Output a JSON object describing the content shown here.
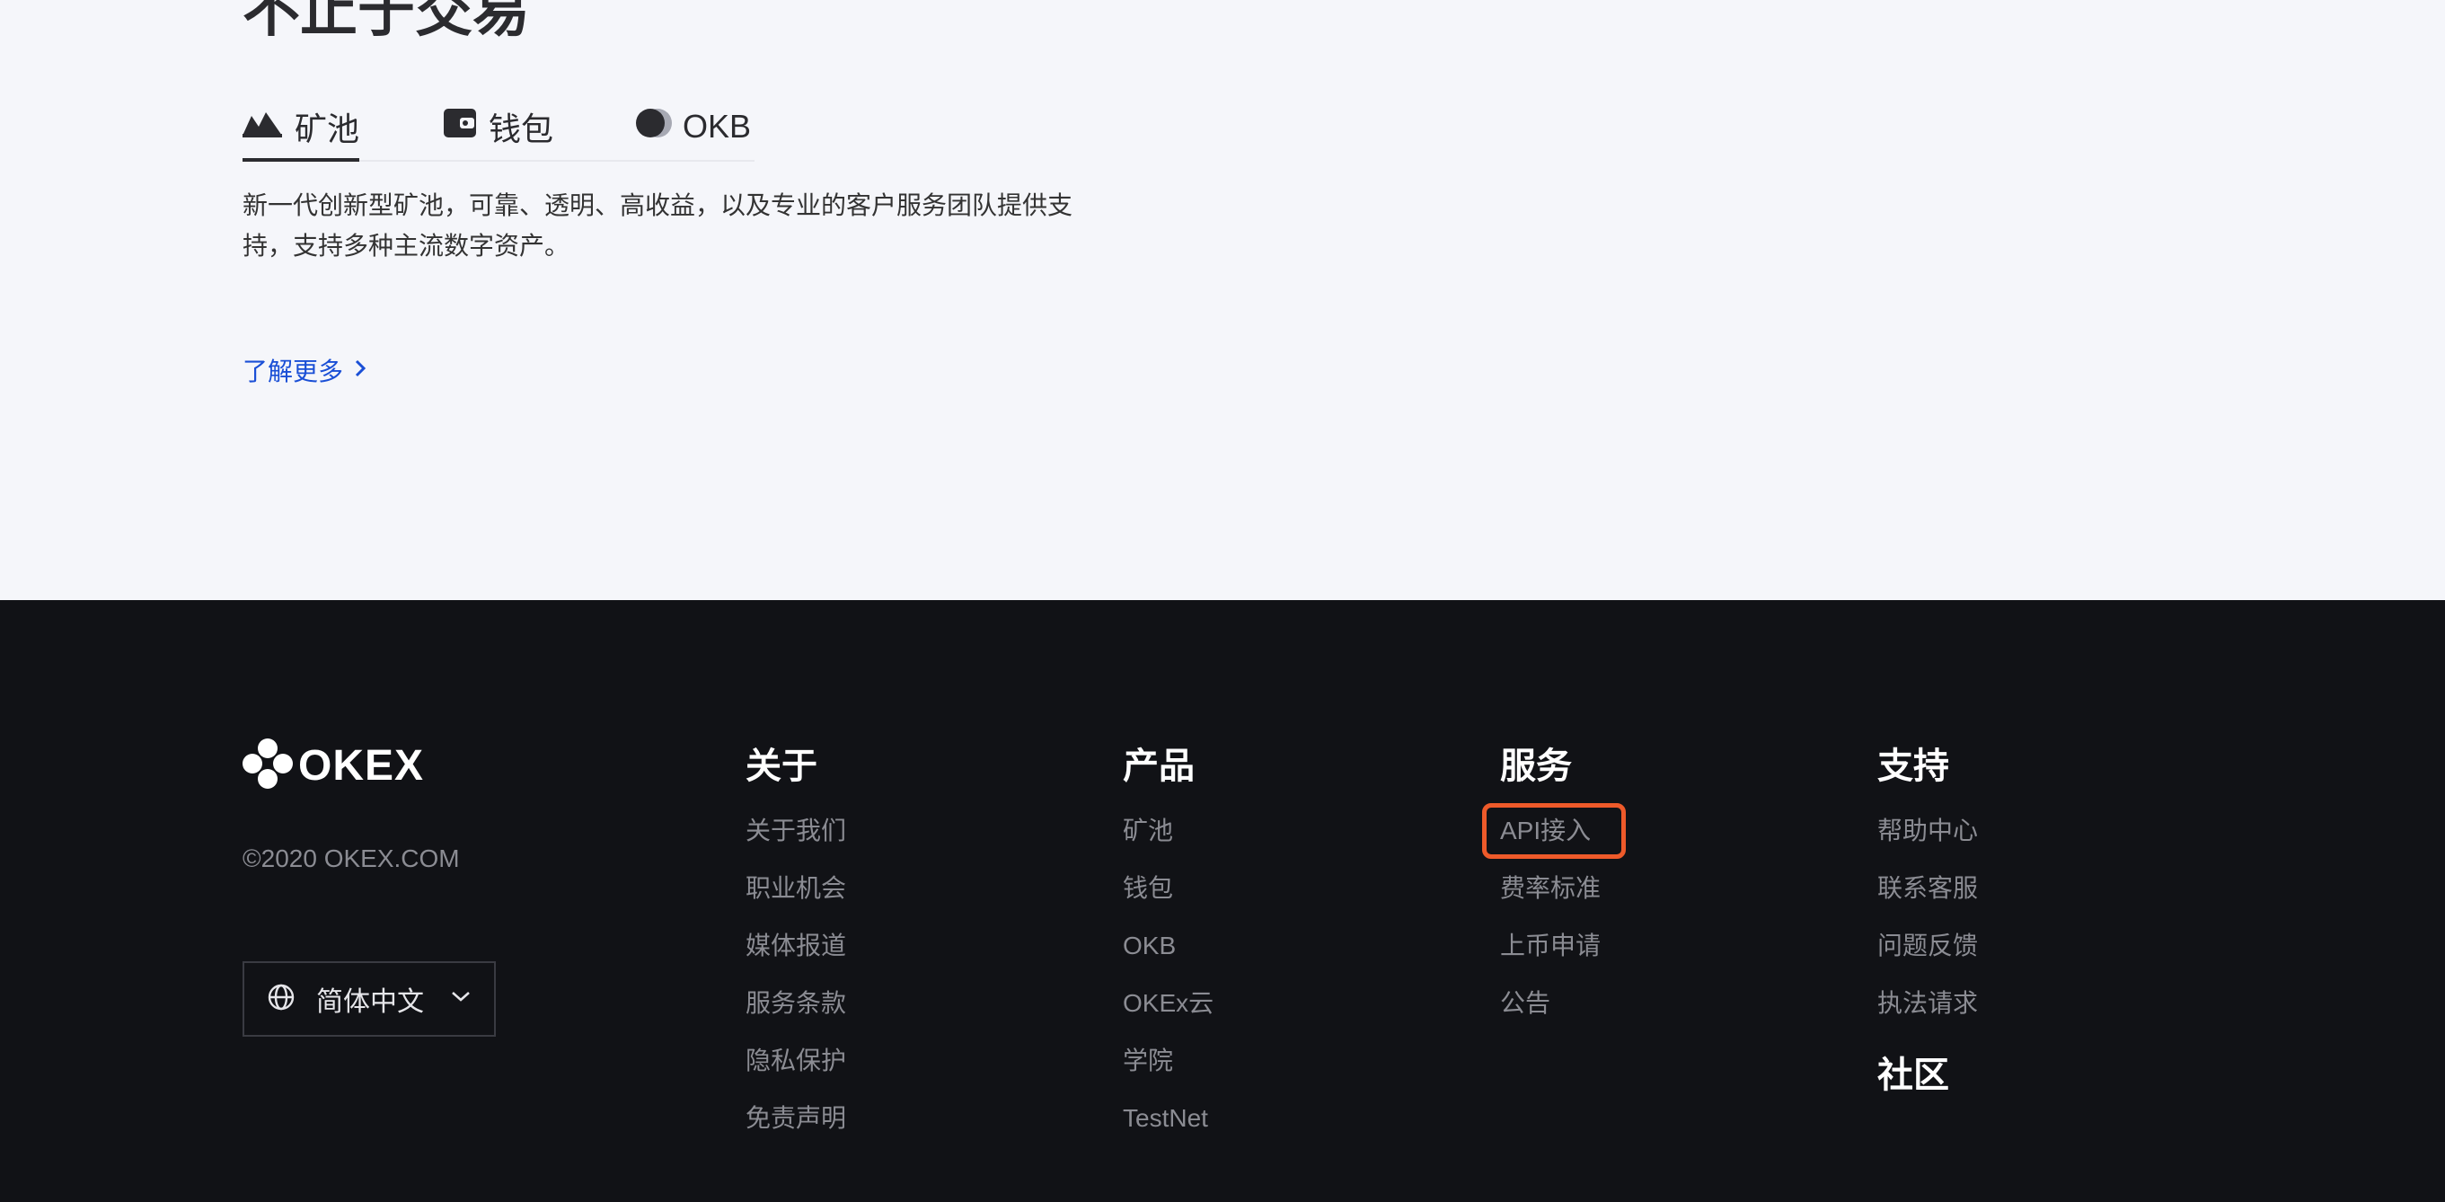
{
  "hero": {
    "title": "不止于交易",
    "tabs": [
      {
        "label": "矿池",
        "icon": "mountain-icon",
        "active": true
      },
      {
        "label": "钱包",
        "icon": "wallet-icon",
        "active": false
      },
      {
        "label": "OKB",
        "icon": "okb-coin-icon",
        "active": false
      }
    ],
    "description": "新一代创新型矿池，可靠、透明、高收益，以及专业的客户服务团队提供支持，支持多种主流数字资产。",
    "learn_more": "了解更多"
  },
  "footer": {
    "logo_text": "OKEX",
    "copyright": "©2020 OKEX.COM",
    "language": "简体中文",
    "columns": [
      {
        "title": "关于",
        "links": [
          "关于我们",
          "职业机会",
          "媒体报道",
          "服务条款",
          "隐私保护",
          "免责声明"
        ]
      },
      {
        "title": "产品",
        "links": [
          "矿池",
          "钱包",
          "OKB",
          "OKEx云",
          "学院",
          "TestNet"
        ]
      },
      {
        "title": "服务",
        "links": [
          "API接入",
          "费率标准",
          "上币申请",
          "公告"
        ]
      },
      {
        "title": "支持",
        "links": [
          "帮助中心",
          "联系客服",
          "问题反馈",
          "执法请求"
        ]
      }
    ],
    "community_title": "社区"
  },
  "colors": {
    "accent_link": "#1a4fd6",
    "highlight_box": "#ee5a2a",
    "footer_bg": "#111216",
    "top_bg": "#f5f6fa"
  }
}
